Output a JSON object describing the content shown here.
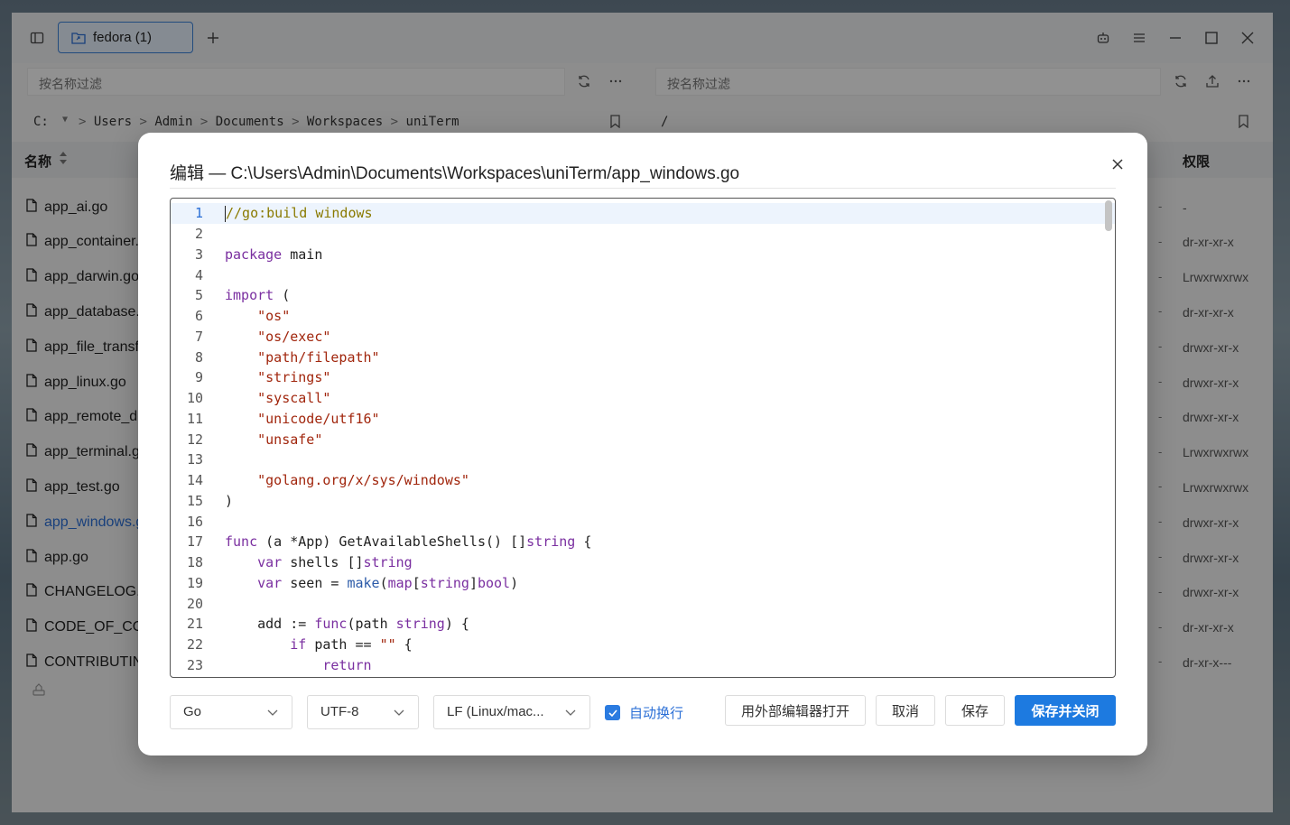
{
  "window": {
    "tab_label": "fedora (1)",
    "left_filter_placeholder": "按名称过滤",
    "right_filter_placeholder": "按名称过滤",
    "path": {
      "drive": "C:",
      "segments": [
        "Users",
        "Admin",
        "Documents",
        "Workspaces",
        "uniTerm"
      ],
      "remote": "/"
    },
    "left_header": "名称",
    "right_header": "权限",
    "files": [
      "app_ai.go",
      "app_container.go",
      "app_darwin.go",
      "app_database.go",
      "app_file_transfer.go",
      "app_linux.go",
      "app_remote_desktop.go",
      "app_terminal.go",
      "app_test.go",
      "app_windows.go",
      "app.go",
      "CHANGELOG.md",
      "CODE_OF_CONDUCT.md",
      "CONTRIBUTING.md"
    ],
    "selected_file_index": 9,
    "permissions": [
      "-",
      "dr-xr-xr-x",
      "Lrwxrwxrwx",
      "dr-xr-xr-x",
      "drwxr-xr-x",
      "drwxr-xr-x",
      "drwxr-xr-x",
      "Lrwxrwxrwx",
      "Lrwxrwxrwx",
      "drwxr-xr-x",
      "drwxr-xr-x",
      "drwxr-xr-x",
      "dr-xr-xr-x",
      "dr-xr-x---"
    ]
  },
  "modal": {
    "title": "编辑 — C:\\Users\\Admin\\Documents\\Workspaces\\uniTerm/app_windows.go",
    "active_line": 1,
    "footer": {
      "language": "Go",
      "encoding": "UTF-8",
      "line_ending": "LF (Linux/mac...",
      "word_wrap_label": "自动换行",
      "word_wrap_checked": true,
      "open_external_label": "用外部编辑器打开",
      "cancel_label": "取消",
      "save_label": "保存",
      "save_close_label": "保存并关闭"
    },
    "code_lines": [
      "//go:build windows",
      "",
      "package main",
      "",
      "import (",
      "    \"os\"",
      "    \"os/exec\"",
      "    \"path/filepath\"",
      "    \"strings\"",
      "    \"syscall\"",
      "    \"unicode/utf16\"",
      "    \"unsafe\"",
      "",
      "    \"golang.org/x/sys/windows\"",
      ")",
      "",
      "func (a *App) GetAvailableShells() []string {",
      "    var shells []string",
      "    var seen = make(map[string]bool)",
      "",
      "    add := func(path string) {",
      "        if path == \"\" {",
      "            return"
    ]
  },
  "colors": {
    "accent": "#1d7ae0",
    "keyword": "#7a2fa0",
    "string": "#a1260d",
    "comment": "#8a7a00"
  }
}
